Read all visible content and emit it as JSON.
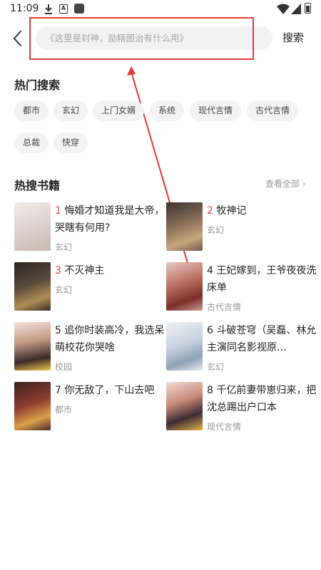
{
  "status": {
    "time": "11:09"
  },
  "search": {
    "placeholder": "《这里是封神，励精图治有什么用》",
    "button_label": "搜索"
  },
  "hot_search": {
    "title": "热门搜索",
    "tags": [
      "都市",
      "玄幻",
      "上门女婿",
      "系统",
      "现代言情",
      "古代言情",
      "总裁",
      "快穿"
    ]
  },
  "hot_books": {
    "title": "热搜书籍",
    "view_all": "查看全部",
    "books": [
      {
        "rank": "1",
        "title": "悔婚才知道我是大帝，哭瞎有何用?",
        "category": "玄幻"
      },
      {
        "rank": "2",
        "title": "牧神记",
        "category": "玄幻"
      },
      {
        "rank": "3",
        "title": "不灭神主",
        "category": "玄幻"
      },
      {
        "rank": "4",
        "title": "王妃嫁到，王爷夜夜洗床单",
        "category": "古代言情"
      },
      {
        "rank": "5",
        "title": "追你时装高冷，我选呆萌校花你哭啥",
        "category": "校园"
      },
      {
        "rank": "6",
        "title": "斗破苍穹（吴磊、林允主演同名影视原…",
        "category": "玄幻"
      },
      {
        "rank": "7",
        "title": "你无敌了，下山去吧",
        "category": "都市"
      },
      {
        "rank": "8",
        "title": "千亿前妻带崽归来，把沈总踢出户口本",
        "category": "现代言情"
      }
    ]
  },
  "colors": {
    "accent": "#e23a3a",
    "rank_top": "#e0473b"
  }
}
